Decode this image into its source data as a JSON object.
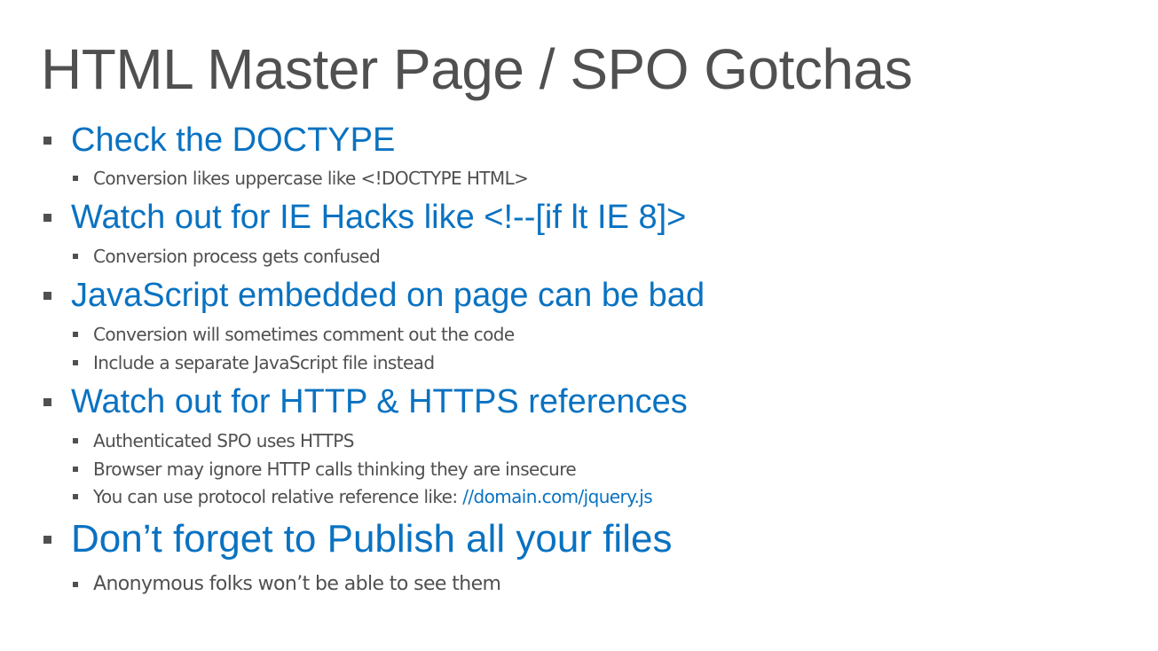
{
  "slide": {
    "title": "HTML Master Page / SPO Gotchas",
    "sections": [
      {
        "heading": "Check the DOCTYPE",
        "items": [
          {
            "text": "Conversion likes uppercase like <!DOCTYPE HTML>"
          }
        ]
      },
      {
        "heading": "Watch out for IE Hacks like <!--[if lt IE 8]>",
        "items": [
          {
            "text": "Conversion process gets confused"
          }
        ]
      },
      {
        "heading": "JavaScript embedded on page can be bad",
        "items": [
          {
            "text": "Conversion will sometimes comment out the code"
          },
          {
            "text": "Include a separate JavaScript file instead"
          }
        ]
      },
      {
        "heading": "Watch out for HTTP & HTTPS references",
        "items": [
          {
            "text": "Authenticated SPO uses HTTPS"
          },
          {
            "text": "Browser may ignore HTTP calls thinking they are insecure"
          },
          {
            "text": "You can use protocol relative reference like: ",
            "link": "//domain.com/jquery.js"
          }
        ]
      },
      {
        "heading": "Don’t forget to Publish all your files",
        "items": [
          {
            "text": "Anonymous folks won’t be able to see them"
          }
        ]
      }
    ]
  },
  "colors": {
    "title": "#505050",
    "heading": "#0a72c1",
    "body": "#505050",
    "link": "#0a72c1"
  }
}
